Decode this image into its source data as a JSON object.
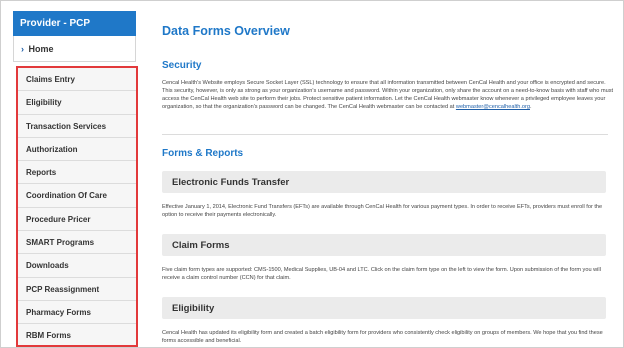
{
  "sidebar": {
    "header": "Provider - PCP",
    "home": "Home",
    "items": [
      "Claims Entry",
      "Eligibility",
      "Transaction Services",
      "Authorization",
      "Reports",
      "Coordination Of Care",
      "Procedure Pricer",
      "SMART Programs",
      "Downloads",
      "PCP Reassignment",
      "Pharmacy Forms",
      "RBM Forms"
    ]
  },
  "main": {
    "title": "Data Forms Overview",
    "security": {
      "heading": "Security",
      "text": "Cencal Health's Website employs Secure Socket Layer (SSL) technology to ensure that all information transmitted between CenCal Health and your office is encrypted and secure. This security, however, is only as strong as your organization's username and password. Within your organization, only share the account on a need-to-know basis with staff who must access the CenCal Health web site to perform their jobs. Protect sensitive patient information. Let the CenCal Health webmaster know whenever a privileged employee leaves your organization, so that the organization's password can be changed. The CenCal Health webmaster can be contacted at",
      "email": "webmaster@cencalhealth.org",
      "end": "."
    },
    "forms_heading": "Forms & Reports",
    "eft": {
      "heading": "Electronic Funds Transfer",
      "text": "Effective January 1, 2014, Electronic Fund Transfers (EFTs) are available through CenCal Health for various payment types. In order to receive EFTs, providers must enroll for the option to receive their payments electronically."
    },
    "claim": {
      "heading": "Claim Forms",
      "text": "Five claim form types are supported: CMS-1500, Medical Supplies, UB-04 and LTC. Click on the claim form type on the left to view the form. Upon submission of the form you will receive a claim control number (CCN) for that claim."
    },
    "eligibility": {
      "heading": "Eligibility",
      "text": "Cencal Health has updated its eligibility form and created a batch eligibility form for providers who consistently check eligibility on groups of members. We hope that you find these forms accessible and beneficial."
    }
  }
}
